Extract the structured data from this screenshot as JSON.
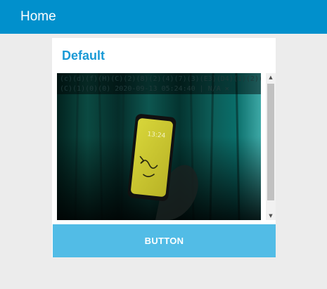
{
  "app_bar": {
    "title": "Home",
    "color": "#0190cc"
  },
  "card": {
    "title": "Default",
    "title_color": "#1a9ad6"
  },
  "image_viewer": {
    "overlay_lines": [
      "(c)(d)(f)(H)(C)(2)(8)(2)(4)(7)(3)(E3)(D4)(1)(2)(4)",
      "(C)(1)(0)(0) 2020-09-13 05:24:40 | N/A ✕"
    ],
    "phone_clock": "13:24",
    "scroll_up_icon": "triangle-up",
    "scroll_down_icon": "triangle-down"
  },
  "button": {
    "label": "BUTTON",
    "color": "#52bce6"
  }
}
